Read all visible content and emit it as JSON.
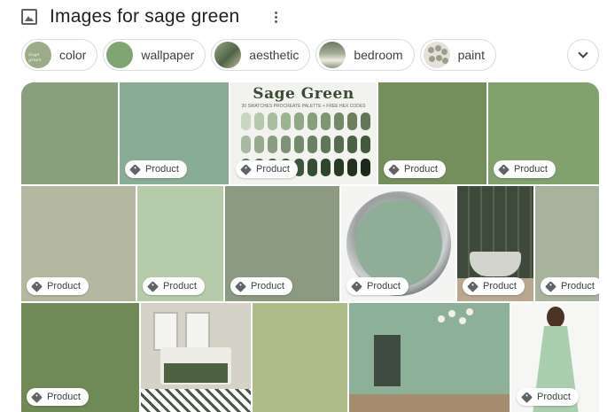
{
  "header": {
    "title": "Images for sage green",
    "icon": "image-icon",
    "more_icon": "more-vert-icon"
  },
  "chips": [
    {
      "label": "color",
      "thumb_text": "Sage green"
    },
    {
      "label": "wallpaper"
    },
    {
      "label": "aesthetic"
    },
    {
      "label": "bedroom"
    },
    {
      "label": "paint"
    }
  ],
  "expand_icon": "chevron-down-icon",
  "palette_tile": {
    "title": "Sage Green",
    "subtitle": "30 SWATCHES PROCREATE PALETTE + FREE HEX CODES"
  },
  "badge_label": "Product",
  "tiles": [
    {
      "row": 1,
      "color": "#8a9f7c",
      "badge": false
    },
    {
      "row": 1,
      "color": "#89ad94",
      "badge": true
    },
    {
      "row": 1,
      "kind": "palette",
      "badge": true
    },
    {
      "row": 1,
      "color": "#748f5c",
      "badge": true
    },
    {
      "row": 1,
      "color": "#82a26d",
      "badge": true
    },
    {
      "row": 2,
      "color": "#b5b8a0",
      "badge": true
    },
    {
      "row": 2,
      "color": "#b5cbaa",
      "badge": true
    },
    {
      "row": 2,
      "color": "#8c9a81",
      "badge": true
    },
    {
      "row": 2,
      "kind": "paint-can",
      "badge": true
    },
    {
      "row": 2,
      "kind": "stripes",
      "badge": true
    },
    {
      "row": 2,
      "color": "#a8b39e",
      "badge": true
    },
    {
      "row": 3,
      "color": "#6f8a56",
      "badge": true
    },
    {
      "row": 3,
      "kind": "bedroom",
      "badge": false
    },
    {
      "row": 3,
      "color": "#aebd8a",
      "badge": false
    },
    {
      "row": 3,
      "kind": "room",
      "badge": false
    },
    {
      "row": 3,
      "kind": "dress",
      "badge": true
    }
  ],
  "colors": {
    "chip_border": "#dadce0",
    "text": "#202124",
    "icon": "#5f6368"
  }
}
